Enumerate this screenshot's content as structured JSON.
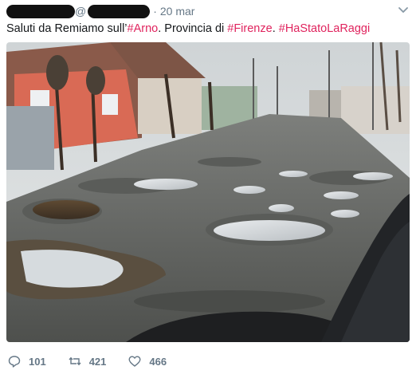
{
  "tweet": {
    "handle_prefix": "@",
    "separator": "·",
    "date": "20 mar",
    "text_parts": [
      {
        "text": "Saluti da Remiamo sull’",
        "tag": false
      },
      {
        "text": "#Arno",
        "tag": true
      },
      {
        "text": ". Provincia di ",
        "tag": false
      },
      {
        "text": "#Firenze",
        "tag": true
      },
      {
        "text": ". ",
        "tag": false
      },
      {
        "text": "#HaStatoLaRaggi",
        "tag": true
      }
    ]
  },
  "actions": {
    "replies": "101",
    "retweets": "421",
    "likes": "466"
  },
  "icons": {
    "reply": "reply-icon",
    "retweet": "retweet-icon",
    "like": "heart-icon",
    "menu": "chevron-down-icon"
  },
  "colors": {
    "hashtag": "#e0245e",
    "meta": "#657786"
  }
}
